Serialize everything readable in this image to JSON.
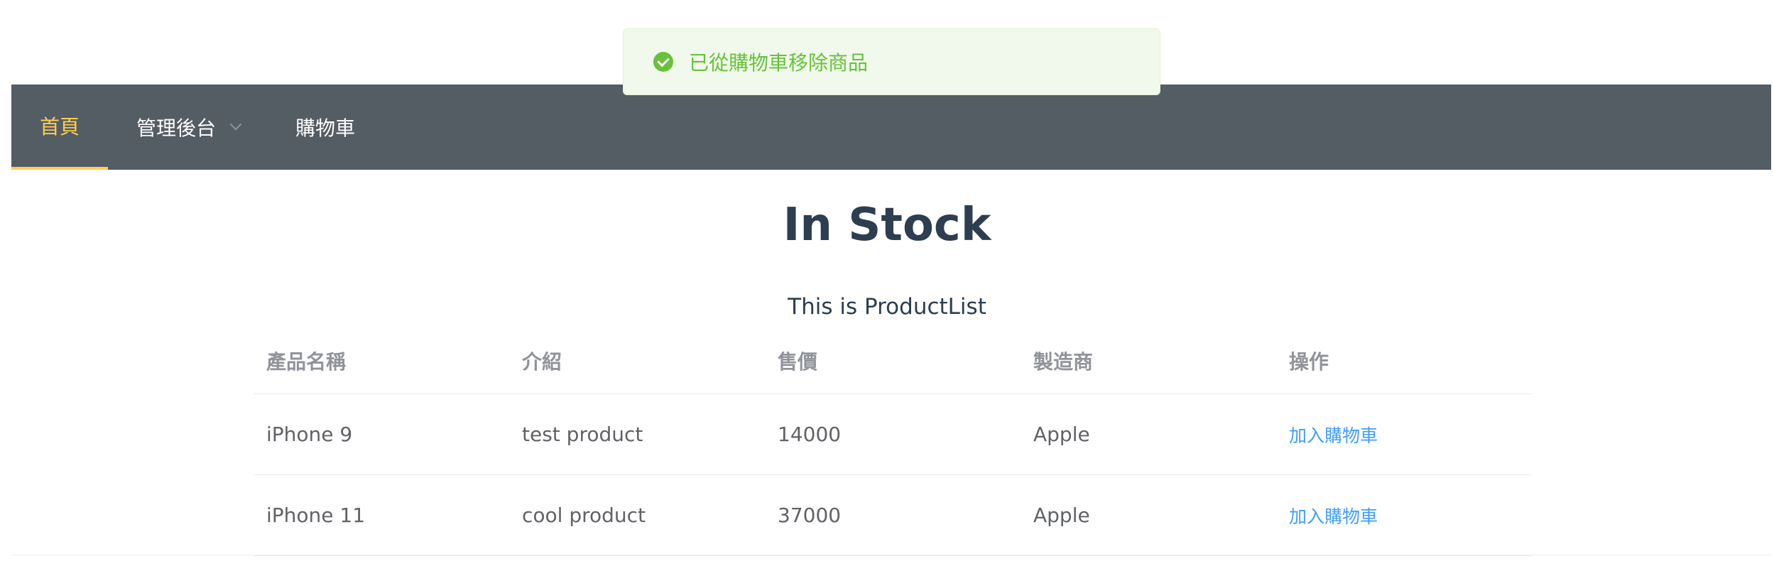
{
  "toast": {
    "message": "已從購物車移除商品",
    "icon": "success-check-icon",
    "color": "#67c23a"
  },
  "nav": {
    "items": [
      {
        "label": "首頁",
        "active": true
      },
      {
        "label": "管理後台",
        "has_dropdown": true
      },
      {
        "label": "購物車"
      }
    ],
    "background": "#545c64",
    "active_color": "#ffd04b"
  },
  "page": {
    "title": "In Stock",
    "subtitle": "This is ProductList"
  },
  "table": {
    "columns": [
      "產品名稱",
      "介紹",
      "售價",
      "製造商",
      "操作"
    ],
    "rows": [
      {
        "name": "iPhone 9",
        "intro": "test product",
        "price": "14000",
        "maker": "Apple",
        "action": "加入購物車"
      },
      {
        "name": "iPhone 11",
        "intro": "cool product",
        "price": "37000",
        "maker": "Apple",
        "action": "加入購物車"
      }
    ],
    "link_color": "#409eff"
  }
}
